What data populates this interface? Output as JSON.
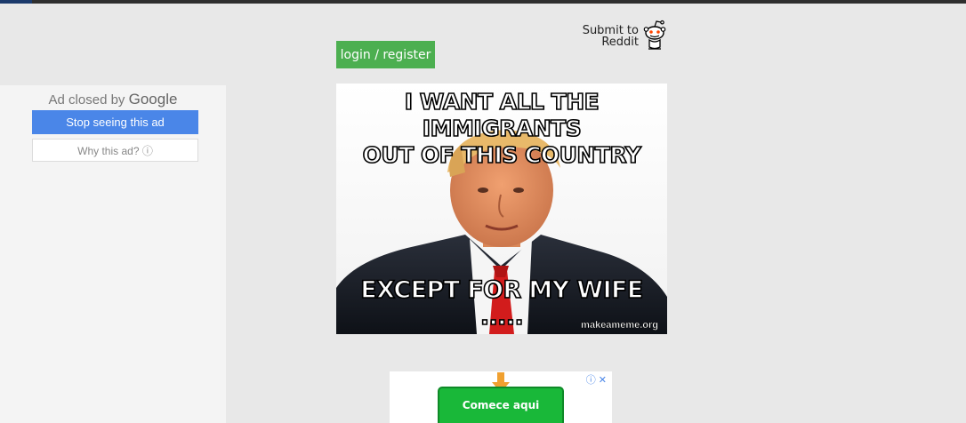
{
  "header": {
    "login_label": "login / register",
    "reddit_line1": "Submit to",
    "reddit_line2": "Reddit"
  },
  "sidebar_ad": {
    "closed_prefix": "Ad closed by",
    "brand": "Google",
    "stop_label": "Stop seeing this ad",
    "why_label": "Why this ad? ⓘ"
  },
  "meme": {
    "top_line1": "I WANT ALL THE IMMIGRANTS",
    "top_line2": "OUT OF THIS COUNTRY",
    "bottom_text": "EXCEPT FOR MY WIFE .....",
    "watermark": "makeameme.org"
  },
  "bottom_ad": {
    "cta_label": "Comece aqui",
    "info_icons": "ⓘ ✕"
  },
  "colors": {
    "login_green": "#4caf50",
    "google_blue": "#4a86e8",
    "cta_green": "#19b839"
  },
  "icons": [
    "reddit-alien-icon",
    "info-icon",
    "close-icon",
    "down-arrow-icon"
  ]
}
